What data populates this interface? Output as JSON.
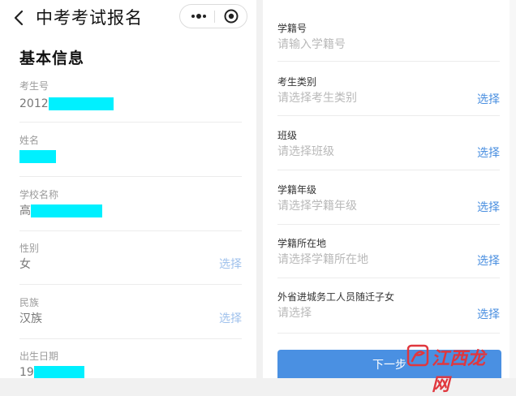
{
  "left": {
    "nav": {
      "title": "中考考试报名",
      "back_icon": "chevron-left-icon",
      "more_icon": "ellipsis-icon",
      "close_icon": "target-icon"
    },
    "section_title": "基本信息",
    "fields": [
      {
        "label": "考生号",
        "value_prefix": "2012"
      },
      {
        "label": "姓名",
        "value_prefix": ""
      },
      {
        "label": "学校名称",
        "value_prefix": "高"
      },
      {
        "label": "性别",
        "value": "女",
        "action": "选择"
      },
      {
        "label": "民族",
        "value": "汉族",
        "action": "选择"
      },
      {
        "label": "出生日期",
        "value_prefix": "19"
      }
    ]
  },
  "right": {
    "fields": [
      {
        "label": "学籍号",
        "placeholder": "请输入学籍号"
      },
      {
        "label": "考生类别",
        "placeholder": "请选择考生类别",
        "action": "选择"
      },
      {
        "label": "班级",
        "placeholder": "请选择班级",
        "action": "选择"
      },
      {
        "label": "学籍年级",
        "placeholder": "请选择学籍年级",
        "action": "选择"
      },
      {
        "label": "学籍所在地",
        "placeholder": "请选择学籍所在地",
        "action": "选择"
      },
      {
        "label": "外省进城务工人员随迁子女",
        "placeholder": "请选择",
        "action": "选择"
      }
    ],
    "next_button": "下一步"
  },
  "watermark": {
    "text": "江西龙网"
  },
  "colors": {
    "accent": "#4a90e2",
    "mask": "#00f0ff",
    "watermark": "#e0373e"
  }
}
